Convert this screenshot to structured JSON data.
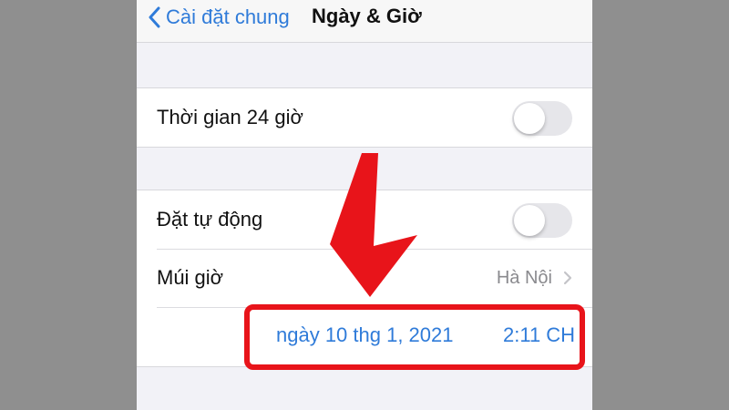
{
  "navbar": {
    "back_label": "Cài đặt chung",
    "title": "Ngày & Giờ"
  },
  "settings": {
    "time_24h": {
      "label": "Thời gian 24 giờ",
      "enabled": false
    },
    "set_automatically": {
      "label": "Đặt tự động",
      "enabled": false
    },
    "time_zone": {
      "label": "Múi giờ",
      "value": "Hà Nội"
    },
    "date_value": "ngày 10 thg 1, 2021",
    "time_value": "2:11 CH"
  },
  "colors": {
    "accent": "#2f7bd9",
    "annotation": "#e8141a",
    "background": "#f2f2f7"
  },
  "icons": [
    "chevron-left-icon",
    "chevron-right-icon",
    "arrow-down-icon"
  ]
}
